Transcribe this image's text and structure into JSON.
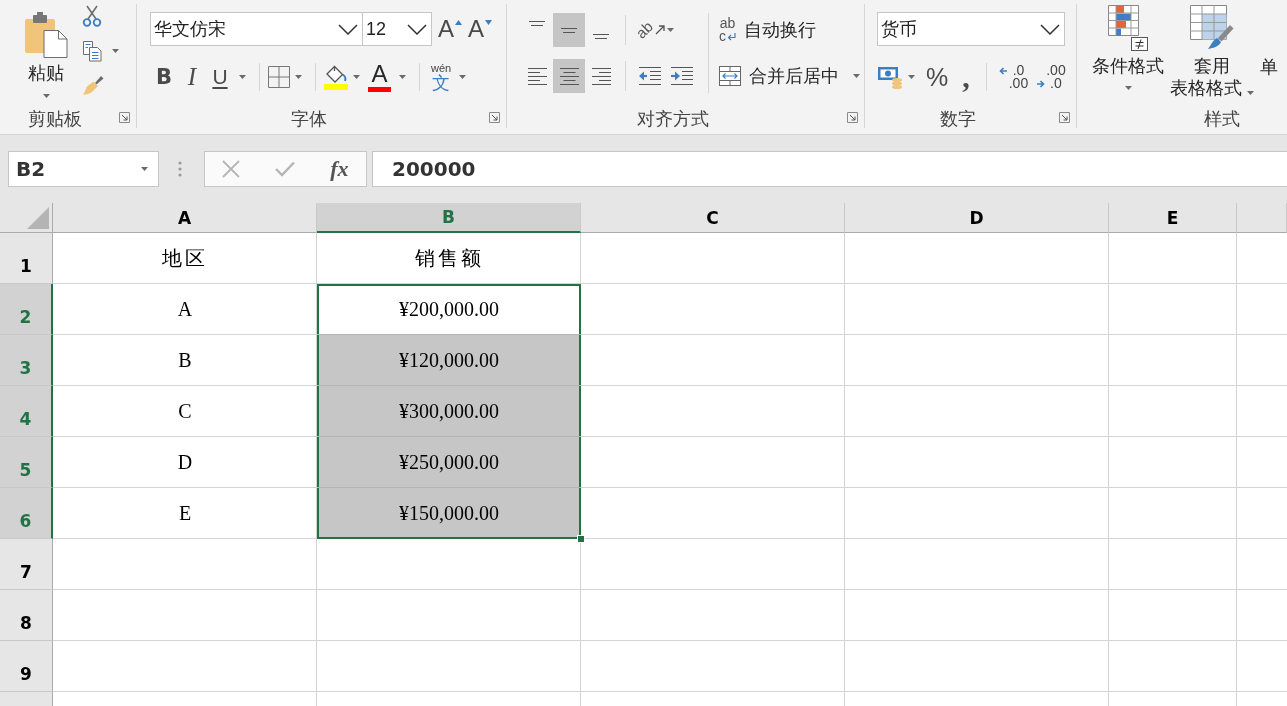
{
  "ribbon": {
    "clipboard": {
      "paste": "粘贴",
      "label": "剪贴板"
    },
    "font": {
      "font_name": "华文仿宋",
      "font_size": "12",
      "grow_font": "A",
      "shrink_font": "A",
      "bold": "B",
      "italic": "I",
      "underline": "U",
      "font_color": "A",
      "phonetic_ruby": "wén",
      "phonetic_base": "文",
      "label": "字体"
    },
    "alignment": {
      "vertical": [
        {
          "kind": "top",
          "selected": false
        },
        {
          "kind": "middle",
          "selected": true
        },
        {
          "kind": "bottom",
          "selected": false
        }
      ],
      "horizontal": [
        {
          "kind": "left",
          "selected": false
        },
        {
          "kind": "center",
          "selected": true
        },
        {
          "kind": "right",
          "selected": false
        }
      ],
      "orientation": "ab",
      "wrap_glyph": [
        "ab",
        "c"
      ],
      "wrap_text": "自动换行",
      "merge_center": "合并后居中",
      "label": "对齐方式"
    },
    "number": {
      "format": "货币",
      "percent": "%",
      "comma": ",",
      "increase_decimal": [
        ".0",
        ".00"
      ],
      "decrease_decimal": [
        ".00",
        ".0"
      ],
      "label": "数字"
    },
    "styles": {
      "conditional_formatting": "条件格式",
      "format_as_table": [
        "套用",
        "表格格式"
      ],
      "cell_styles": "单",
      "label": "样式"
    }
  },
  "formula_bar": {
    "name_box": "B2",
    "function_label": "fx",
    "value": "200000"
  },
  "sheet": {
    "columns": [
      {
        "label": "A",
        "selected": false
      },
      {
        "label": "B",
        "selected": true
      },
      {
        "label": "C",
        "selected": false
      },
      {
        "label": "D",
        "selected": false
      },
      {
        "label": "E",
        "selected": false
      }
    ],
    "rows": [
      {
        "label": "1",
        "selected": false,
        "cells": [
          {
            "text": "地区",
            "selected": false,
            "active": false
          },
          {
            "text": "销售额",
            "selected": false,
            "active": false
          }
        ]
      },
      {
        "label": "2",
        "selected": true,
        "cells": [
          {
            "text": "A",
            "selected": false,
            "active": false
          },
          {
            "text": "¥200,000.00",
            "selected": true,
            "active": true
          }
        ]
      },
      {
        "label": "3",
        "selected": true,
        "cells": [
          {
            "text": "B",
            "selected": false,
            "active": false
          },
          {
            "text": "¥120,000.00",
            "selected": true,
            "active": false
          }
        ]
      },
      {
        "label": "4",
        "selected": true,
        "cells": [
          {
            "text": "C",
            "selected": false,
            "active": false
          },
          {
            "text": "¥300,000.00",
            "selected": true,
            "active": false
          }
        ]
      },
      {
        "label": "5",
        "selected": true,
        "cells": [
          {
            "text": "D",
            "selected": false,
            "active": false
          },
          {
            "text": "¥250,000.00",
            "selected": true,
            "active": false
          }
        ]
      },
      {
        "label": "6",
        "selected": true,
        "cells": [
          {
            "text": "E",
            "selected": false,
            "active": false
          },
          {
            "text": "¥150,000.00",
            "selected": true,
            "active": false
          }
        ]
      },
      {
        "label": "7",
        "selected": false
      },
      {
        "label": "8",
        "selected": false
      },
      {
        "label": "9",
        "selected": false
      }
    ]
  }
}
